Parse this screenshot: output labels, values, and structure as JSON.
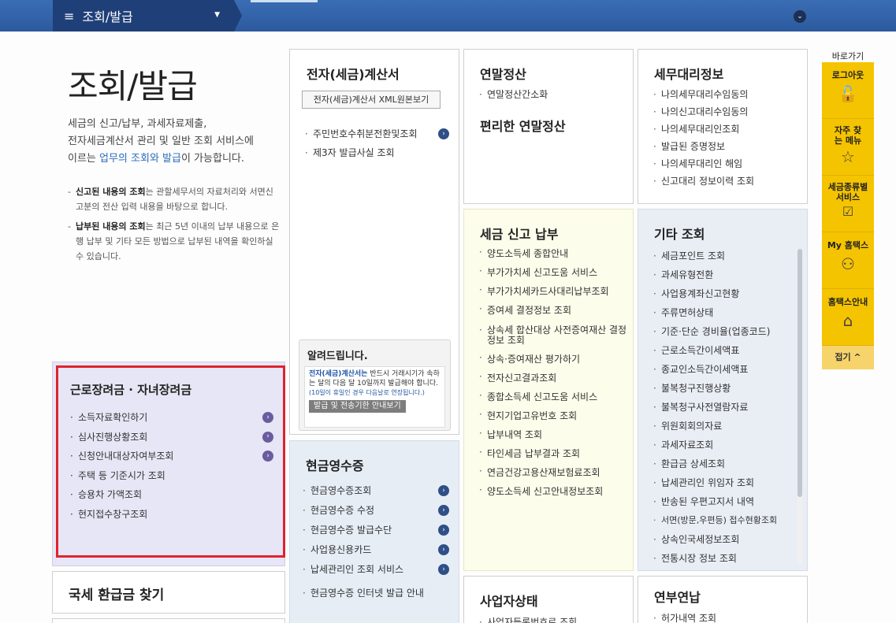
{
  "topbar": {
    "menu_icon": "≡",
    "breadcrumb": "조회/발급",
    "dropdown_icon": "▼",
    "expand_icon": "⌄"
  },
  "intro": {
    "title": "조회/발급",
    "line1": "세금의 신고/납부, 과세자료제출,",
    "line2": "전자세금계산서 관리 및 일반 조회 서비스에",
    "line3_pre": "이르는 ",
    "line3_hl": "업무의 조회와 발급",
    "line3_post": "이 가능합니다.",
    "note1_b": "신고된 내용의 조회",
    "note1": "는 관할세무서의 자료처리와 서면신고분의 전산 입력 내용을 바탕으로 합니다.",
    "note2_b": "납부된 내용의 조회",
    "note2": "는 최근 5년 이내의 납부 내용으로 은행 납부 및 기타 모든 방법으로 납부된 내역을 확인하실 수 있습니다."
  },
  "etax": {
    "title": "전자(세금)계산서",
    "xml_button": "전자(세금)계산서 XML원본보기",
    "items": [
      "주민번호수취분전환및조회",
      "제3자 발급사실 조회"
    ],
    "notice_title": "알려드립니다.",
    "notice_text_b": "전자(세금)계산서는",
    "notice_text": " 반드시 거래시기가 속하는 달의 다음 달 10일까지 발급해야 합니다.",
    "notice_sub": "(10일이 휴일인 경우 다음날로 연장됩니다.)",
    "notice_button": "발급 및 전송기한 안내보기"
  },
  "yearend": {
    "title": "연말정산",
    "items": [
      "연말정산간소화"
    ],
    "subtitle": "편리한 연말정산"
  },
  "agent": {
    "title": "세무대리정보",
    "items": [
      "나의세무대리수임동의",
      "나의신고대리수임동의",
      "나의세무대리인조회",
      "발급된 증명정보",
      "나의세무대리인 해임",
      "신고대리 정보이력 조회"
    ]
  },
  "tax_filing": {
    "title": "세금 신고 납부",
    "items": [
      "양도소득세 종합안내",
      "부가가치세 신고도움 서비스",
      "부가가치세카드사대리납부조회",
      "증여세 결정정보 조회",
      "상속세 합산대상 사전증여재산 결정정보 조회",
      "상속·증여재산 평가하기",
      "전자신고결과조회",
      "종합소득세 신고도움 서비스",
      "현지기업고유번호 조회",
      "납부내역 조회",
      "타인세금 납부결과 조회",
      "연금건강고용산재보험료조회",
      "양도소득세 신고안내정보조회"
    ]
  },
  "other": {
    "title": "기타 조회",
    "items": [
      "세금포인트 조회",
      "과세유형전환",
      "사업용계좌신고현황",
      "주류면허상태",
      "기준·단순 경비율(업종코드)",
      "근로소득간이세액표",
      "종교인소득간이세액표",
      "불복청구진행상황",
      "불복청구사전열람자료",
      "위원회회의자료",
      "과세자료조회",
      "환급금 상세조회",
      "납세관리인 위임자 조회",
      "반송된 우편고지서 내역",
      "서면(방문,우편등) 접수현황조회",
      "상속인국세정보조회",
      "전통시장 정보 조회"
    ]
  },
  "eitc": {
    "title": "근로장려금 · 자녀장려금",
    "items": [
      "소득자료확인하기",
      "심사진행상황조회",
      "신청안내대상자여부조회",
      "주택 등 기준시가 조회",
      "승용차 가액조회",
      "현지접수창구조회"
    ]
  },
  "refund": {
    "title": "국세 환급금 찾기"
  },
  "cash_receipt": {
    "title": "현금영수증",
    "items": [
      "현금영수증조회",
      "현금영수증 수정",
      "현금영수증 발급수단",
      "사업용신용카드",
      "납세관리인 조회 서비스",
      "현금영수증 인터넷 발급 안내"
    ]
  },
  "business": {
    "title": "사업자상태",
    "items": [
      "사업자등록번호로 조회"
    ]
  },
  "annual": {
    "title": "연부연납",
    "items": [
      "허가내역 조회"
    ]
  },
  "quick": {
    "title": "바로가기",
    "items": [
      {
        "label": "로그아웃",
        "icon": "🔓"
      },
      {
        "label": "자주 찾는 메뉴",
        "icon": "☆"
      },
      {
        "label": "세금종류별 서비스",
        "icon": "☑"
      },
      {
        "label": "My 홈택스",
        "icon": "⚇"
      },
      {
        "label": "홈택스안내",
        "icon": "⌂"
      }
    ],
    "fold": "접기 ^"
  },
  "colors": {
    "topbar": "#2d5a9e",
    "eitc_bg": "#e7e6f6",
    "eitc_border": "#e0232d",
    "tax_bg": "#fdfdeb",
    "other_bg": "#e9eef5",
    "cash_bg": "#e6edf5",
    "quick": "#f5c400"
  }
}
